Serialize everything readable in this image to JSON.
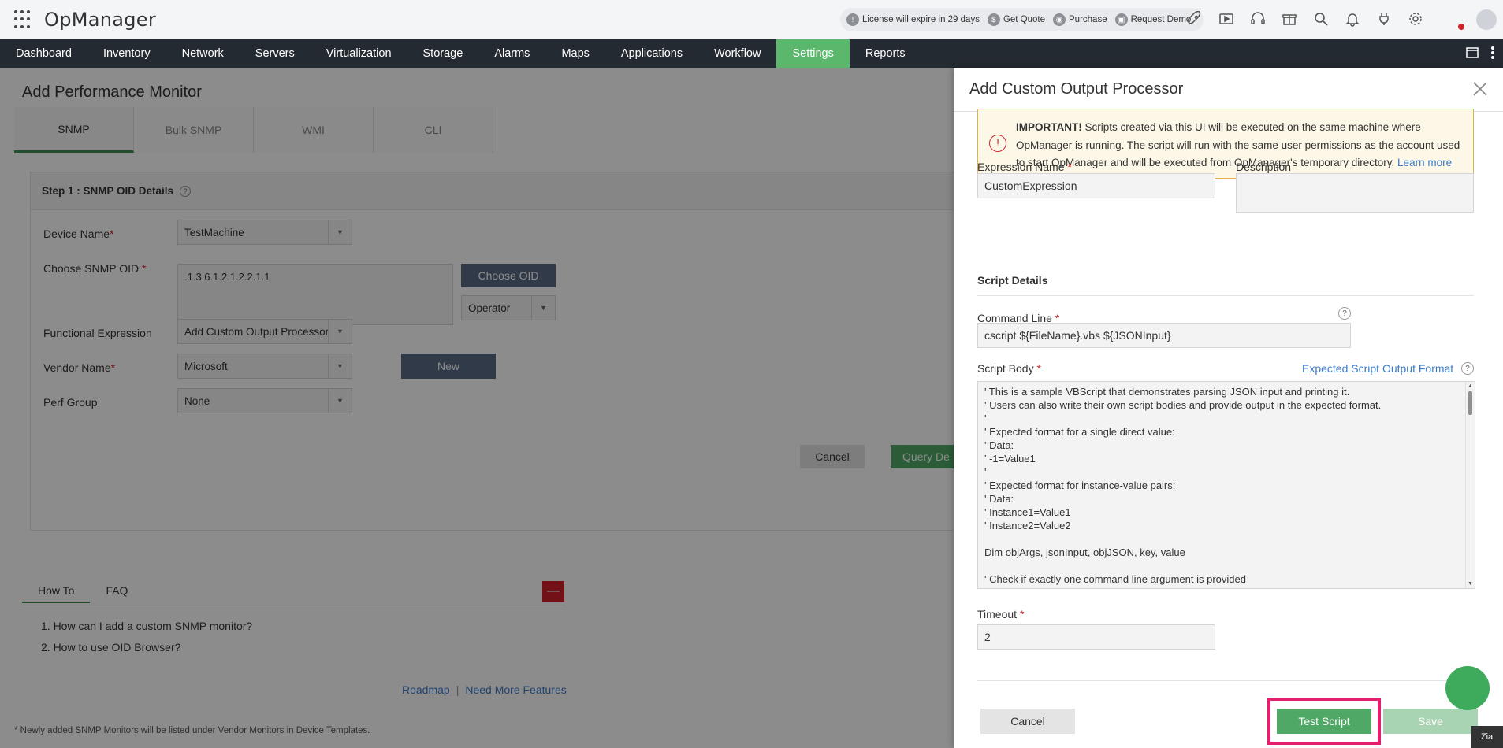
{
  "app": {
    "brand": "OpManager",
    "license_notice": "License will expire in 29 days",
    "get_quote": "Get Quote",
    "purchase": "Purchase",
    "request_demo": "Request Demo"
  },
  "nav": {
    "items": [
      "Dashboard",
      "Inventory",
      "Network",
      "Servers",
      "Virtualization",
      "Storage",
      "Alarms",
      "Maps",
      "Applications",
      "Workflow",
      "Settings",
      "Reports"
    ],
    "active": "Settings"
  },
  "page": {
    "title": "Add Performance Monitor",
    "tabs": [
      "SNMP",
      "Bulk SNMP",
      "WMI",
      "CLI"
    ],
    "active_tab": "SNMP",
    "step_title": "Step 1 : SNMP OID Details",
    "device_name_label": "Device Name",
    "device_name_value": "TestMachine",
    "oid_label": "Choose SNMP OID",
    "oid_value": ".1.3.6.1.2.1.2.2.1.1",
    "choose_oid_button": "Choose OID",
    "operator_value": "Operator",
    "functional_expression_label": "Functional Expression",
    "functional_expression_value": "Add Custom Output Processor",
    "vendor_name_label": "Vendor Name",
    "vendor_name_value": "Microsoft",
    "new_button": "New",
    "perf_group_label": "Perf Group",
    "perf_group_value": "None",
    "cancel_button": "Cancel",
    "query_button": "Query De",
    "howto_tab": "How To",
    "faq_tab": "FAQ",
    "howto_items": [
      "1. How can I add a custom SNMP monitor?",
      "2. How to use OID Browser?"
    ],
    "roadmap_link": "Roadmap",
    "need_features_link": "Need More Features",
    "footnote": "* Newly added SNMP Monitors will be listed under Vendor Monitors in Device Templates."
  },
  "drawer": {
    "title": "Add Custom Output Processor",
    "notice_bold": "IMPORTANT!",
    "notice_text": " Scripts created via this UI will be executed on the same machine where OpManager is running. The script will run with the same user permissions as the account used to start OpManager and will be executed from OpManager's temporary directory. ",
    "notice_link": "Learn more",
    "expression_name_label": "Expression Name",
    "expression_name_value": "CustomExpression",
    "description_label": "Description",
    "description_value": "",
    "script_details_title": "Script Details",
    "command_line_label": "Command Line",
    "command_line_value": "cscript ${FileName}.vbs ${JSONInput}",
    "script_body_label": "Script Body",
    "expected_format_link": "Expected Script Output Format",
    "script_body_value": "' This is a sample VBScript that demonstrates parsing JSON input and printing it.\n' Users can also write their own script bodies and provide output in the expected format.\n'\n' Expected format for a single direct value:\n' Data:\n' -1=Value1\n'\n' Expected format for instance-value pairs:\n' Data:\n' Instance1=Value1\n' Instance2=Value2\n\nDim objArgs, jsonInput, objJSON, key, value\n\n' Check if exactly one command line argument is provided\nSet objArgs = WScript.Arguments",
    "timeout_label": "Timeout",
    "timeout_value": "2",
    "cancel_button": "Cancel",
    "test_script_button": "Test Script",
    "save_button": "Save"
  },
  "misc": {
    "zia_label": "Zia"
  },
  "colors": {
    "nav_bg": "#242a31",
    "active_nav": "#5ab76c",
    "primary_green": "#4fa865",
    "link_blue": "#3a7bc8",
    "highlight_pink": "#e61e6e"
  }
}
